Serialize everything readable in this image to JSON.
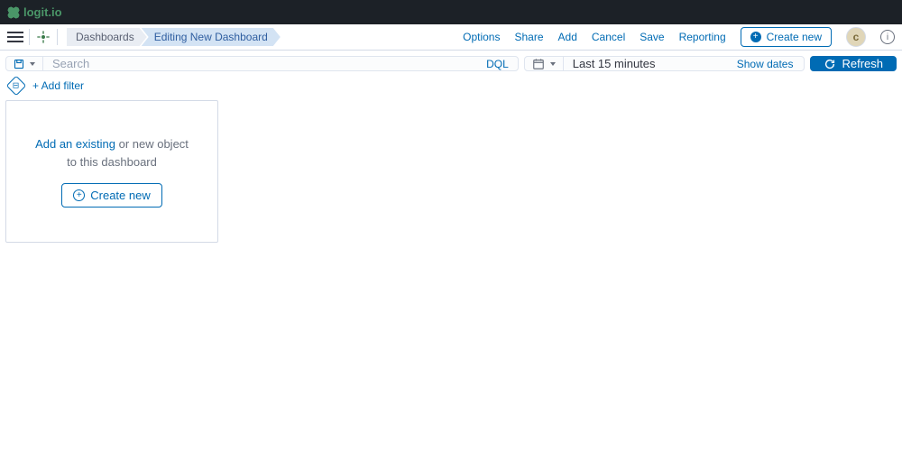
{
  "brand": {
    "name": "logit.io"
  },
  "breadcrumbs": {
    "items": [
      {
        "label": "Dashboards"
      },
      {
        "label": "Editing New Dashboard"
      }
    ]
  },
  "header": {
    "links": {
      "options": "Options",
      "share": "Share",
      "add": "Add",
      "cancel": "Cancel",
      "save": "Save",
      "reporting": "Reporting"
    },
    "create_new": "Create new",
    "avatar_initial": "c"
  },
  "query": {
    "search_placeholder": "Search",
    "dql_label": "DQL",
    "time_range": "Last 15 minutes",
    "show_dates": "Show dates",
    "refresh": "Refresh"
  },
  "filters": {
    "add_filter": "+ Add filter"
  },
  "panel": {
    "add_existing_link": "Add an existing",
    "add_existing_rest": " or new object",
    "to_dashboard": "to this dashboard",
    "create_new": "Create new"
  }
}
